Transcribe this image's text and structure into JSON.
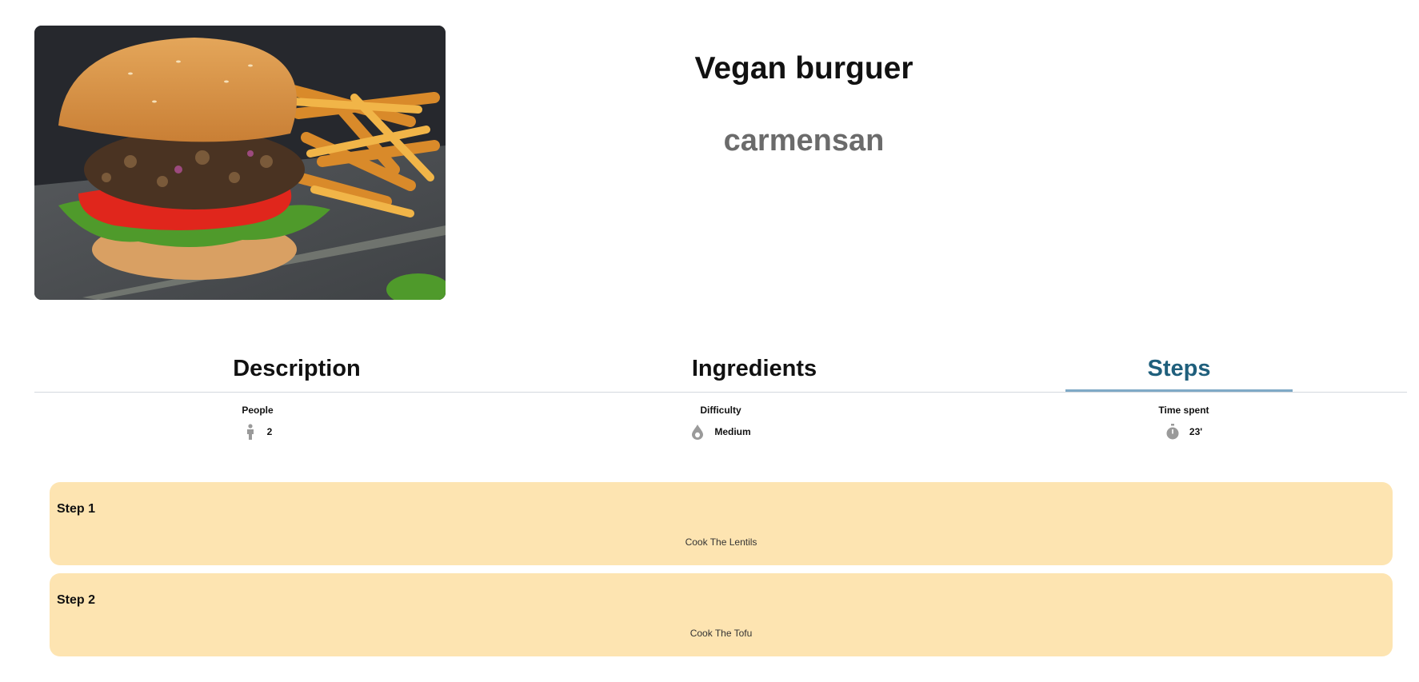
{
  "recipe": {
    "title": "Vegan burguer",
    "author": "carmensan"
  },
  "image": {
    "subject": "veggie burger with fries",
    "icon": "photo"
  },
  "tabs": [
    {
      "label": "Description",
      "active": false
    },
    {
      "label": "Ingredients",
      "active": false
    },
    {
      "label": "Steps",
      "active": true
    }
  ],
  "stats": {
    "people": {
      "label": "People",
      "value": "2",
      "icon": "person-icon"
    },
    "difficulty": {
      "label": "Difficulty",
      "value": "Medium",
      "icon": "drop-icon"
    },
    "time": {
      "label": "Time spent",
      "value": "23'",
      "icon": "stopwatch-icon"
    }
  },
  "steps": [
    {
      "title": "Step 1",
      "text": "Cook The Lentils"
    },
    {
      "title": "Step 2",
      "text": "Cook The Tofu"
    }
  ],
  "colors": {
    "active_tab": "#1f5f7c",
    "active_underline": "#7fa9c6",
    "step_background": "#fde4b1",
    "author_text": "#6b6b6b",
    "icon_gray": "#9a9a9a"
  }
}
